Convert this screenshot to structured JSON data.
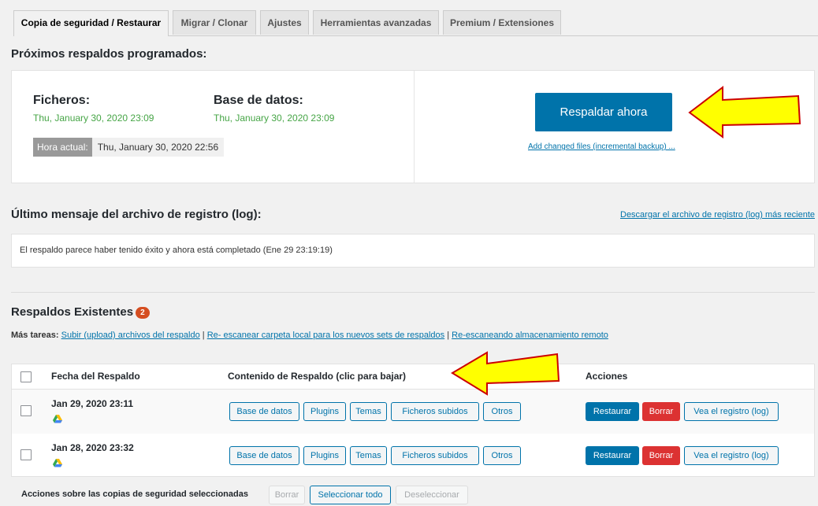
{
  "tabs": [
    {
      "label": "Copia de seguridad / Restaurar"
    },
    {
      "label": "Migrar / Clonar"
    },
    {
      "label": "Ajustes"
    },
    {
      "label": "Herramientas avanzadas"
    },
    {
      "label": "Premium / Extensiones"
    }
  ],
  "scheduled": {
    "title": "Próximos respaldos programados:",
    "files_label": "Ficheros:",
    "files_date": "Thu, January 30, 2020 23:09",
    "db_label": "Base de datos:",
    "db_date": "Thu, January 30, 2020 23:09",
    "current_time_label": "Hora actual:",
    "current_time_value": "Thu, January 30, 2020 22:56",
    "backup_now": "Respaldar ahora",
    "incremental_link": "Add changed files (incremental backup) ..."
  },
  "log": {
    "title": "Último mensaje del archivo de registro (log):",
    "download_link": "Descargar el archivo de registro (log) más reciente",
    "message": "El respaldo parece haber tenido éxito y ahora está completado (Ene 29 23:19:19)"
  },
  "existing": {
    "title": "Respaldos Existentes",
    "count": "2",
    "more_tasks_label": "Más tareas:",
    "link_upload": "Subir (upload) archivos del respaldo",
    "link_rescan_local": "Re- escanear carpeta local para los nuevos sets de respaldos",
    "link_rescan_remote": "Re-escaneando almacenamiento remoto",
    "separator": "|"
  },
  "table": {
    "col_date": "Fecha del Respaldo",
    "col_content": "Contenido de Respaldo (clic para bajar)",
    "col_actions": "Acciones",
    "rows": [
      {
        "date": "Jan 29, 2020 23:11",
        "btn_db": "Base de datos",
        "btn_plugins": "Plugins",
        "btn_themes": "Temas",
        "btn_uploads": "Ficheros subidos",
        "btn_others": "Otros",
        "btn_restore": "Restaurar",
        "btn_delete": "Borrar",
        "btn_log": "Vea el registro (log)"
      },
      {
        "date": "Jan 28, 2020 23:32",
        "btn_db": "Base de datos",
        "btn_plugins": "Plugins",
        "btn_themes": "Temas",
        "btn_uploads": "Ficheros subidos",
        "btn_others": "Otros",
        "btn_restore": "Restaurar",
        "btn_delete": "Borrar",
        "btn_log": "Vea el registro (log)"
      }
    ]
  },
  "bulk": {
    "label": "Acciones sobre las copias de seguridad seleccionadas",
    "delete": "Borrar",
    "select_all": "Seleccionar todo",
    "deselect": "Deseleccionar"
  },
  "colors": {
    "accent": "#0073aa",
    "danger": "#dc3232",
    "success_text": "#46a546",
    "arrow_fill": "#ffff00",
    "arrow_stroke": "#cc0000",
    "badge": "#d54e21"
  },
  "icons": [
    "google-drive-icon",
    "arrow-annotation"
  ]
}
